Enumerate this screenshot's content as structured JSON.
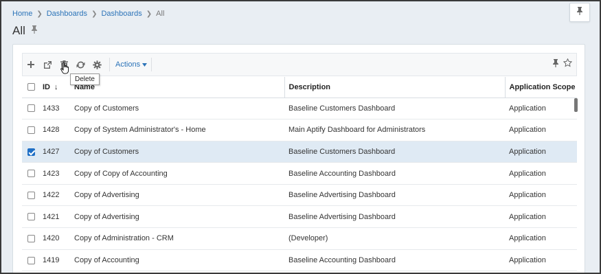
{
  "breadcrumb": {
    "items": [
      "Home",
      "Dashboards",
      "Dashboards"
    ],
    "current": "All"
  },
  "page": {
    "title": "All"
  },
  "toolbar": {
    "actions_label": "Actions",
    "tooltip": "Delete"
  },
  "table": {
    "headers": {
      "id": "ID",
      "name": "Name",
      "description": "Description",
      "scope": "Application Scope"
    },
    "rows": [
      {
        "id": "1433",
        "name": "Copy of Customers",
        "description": "Baseline Customers Dashboard",
        "scope": "Application",
        "checked": false
      },
      {
        "id": "1428",
        "name": "Copy of System Administrator's - Home",
        "description": "Main Aptify Dashboard for Administrators",
        "scope": "Application",
        "checked": false
      },
      {
        "id": "1427",
        "name": "Copy of Customers",
        "description": "Baseline Customers Dashboard",
        "scope": "Application",
        "checked": true
      },
      {
        "id": "1423",
        "name": "Copy of Copy of Accounting",
        "description": "Baseline Accounting Dashboard",
        "scope": "Application",
        "checked": false
      },
      {
        "id": "1422",
        "name": "Copy of Advertising",
        "description": "Baseline Advertising Dashboard",
        "scope": "Application",
        "checked": false
      },
      {
        "id": "1421",
        "name": "Copy of Advertising",
        "description": "Baseline Advertising Dashboard",
        "scope": "Application",
        "checked": false
      },
      {
        "id": "1420",
        "name": "Copy of Administration - CRM",
        "description": "(Developer)",
        "scope": "Application",
        "checked": false
      },
      {
        "id": "1419",
        "name": "Copy of Accounting",
        "description": "Baseline Accounting Dashboard",
        "scope": "Application",
        "checked": false
      }
    ]
  },
  "colors": {
    "link": "#2b73b8",
    "selected_row": "#dfeaf4",
    "checkbox_checked": "#1f6fc5"
  }
}
